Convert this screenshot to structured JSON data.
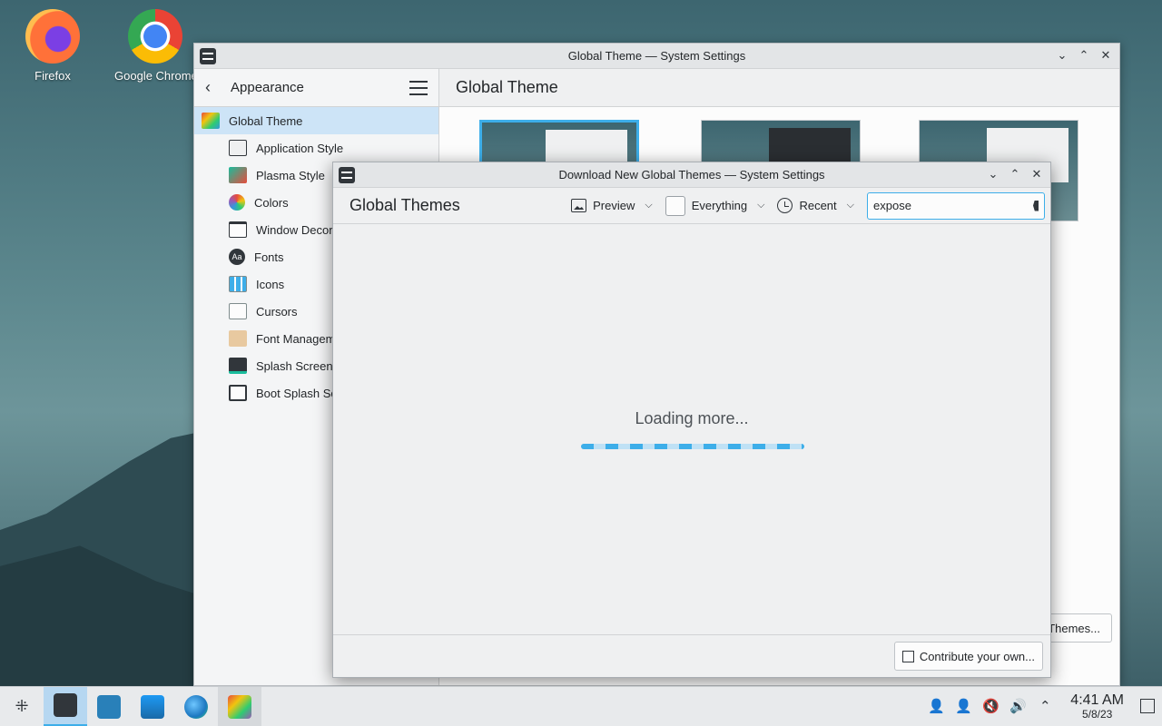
{
  "desktop": {
    "icons": [
      {
        "label": "Firefox",
        "icon": "firefox-icon"
      },
      {
        "label": "Google Chrome",
        "icon": "chrome-icon"
      }
    ]
  },
  "main_window": {
    "title": "Global Theme — System Settings",
    "sidebar": {
      "header": "Appearance",
      "items": [
        {
          "label": "Global Theme",
          "selected": true
        },
        {
          "label": "Application Style"
        },
        {
          "label": "Plasma Style"
        },
        {
          "label": "Colors"
        },
        {
          "label": "Window Decorations"
        },
        {
          "label": "Fonts"
        },
        {
          "label": "Icons"
        },
        {
          "label": "Cursors"
        },
        {
          "label": "Font Management"
        },
        {
          "label": "Splash Screen"
        },
        {
          "label": "Boot Splash Screen"
        }
      ]
    },
    "content_title": "Global Theme",
    "get_button": "Get New Global Themes..."
  },
  "dialog": {
    "title": "Download New Global Themes — System Settings",
    "heading": "Global Themes",
    "view_mode": "Preview",
    "filter": "Everything",
    "sort": "Recent",
    "search_value": "expose",
    "loading_text": "Loading more...",
    "contribute_button": "Contribute your own..."
  },
  "taskbar": {
    "time": "4:41 AM",
    "date": "5/8/23"
  },
  "colors": {
    "accent": "#3daee9",
    "selection": "#cde4f7"
  }
}
